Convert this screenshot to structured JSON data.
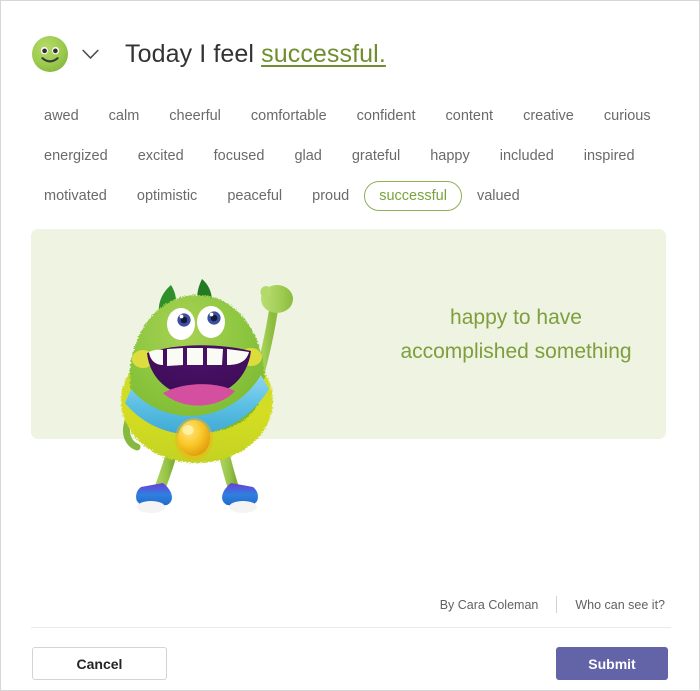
{
  "header": {
    "avatar_icon": "smiley-face-green",
    "chevron_icon": "chevron-down-icon",
    "prefix": "Today I feel ",
    "feeling": "successful."
  },
  "words": [
    {
      "label": "awed",
      "selected": false
    },
    {
      "label": "calm",
      "selected": false
    },
    {
      "label": "cheerful",
      "selected": false
    },
    {
      "label": "comfortable",
      "selected": false
    },
    {
      "label": "confident",
      "selected": false
    },
    {
      "label": "content",
      "selected": false
    },
    {
      "label": "creative",
      "selected": false
    },
    {
      "label": "curious",
      "selected": false
    },
    {
      "label": "energized",
      "selected": false
    },
    {
      "label": "excited",
      "selected": false
    },
    {
      "label": "focused",
      "selected": false
    },
    {
      "label": "glad",
      "selected": false
    },
    {
      "label": "grateful",
      "selected": false
    },
    {
      "label": "happy",
      "selected": false
    },
    {
      "label": "included",
      "selected": false
    },
    {
      "label": "inspired",
      "selected": false
    },
    {
      "label": "motivated",
      "selected": false
    },
    {
      "label": "optimistic",
      "selected": false
    },
    {
      "label": "peaceful",
      "selected": false
    },
    {
      "label": "proud",
      "selected": false
    },
    {
      "label": "successful",
      "selected": true
    },
    {
      "label": "valued",
      "selected": false
    }
  ],
  "panel": {
    "caption_line1": "happy to have",
    "caption_line2": "accomplished something",
    "illustration": "green-furry-monster-raising-arm-with-medal",
    "background_color": "#eff3e1",
    "text_color": "#7d9f3e"
  },
  "attribution": {
    "author": "By Cara Coleman",
    "privacy_link": "Who can see it?"
  },
  "footer": {
    "cancel_label": "Cancel",
    "submit_label": "Submit",
    "submit_color": "#6264a7"
  }
}
